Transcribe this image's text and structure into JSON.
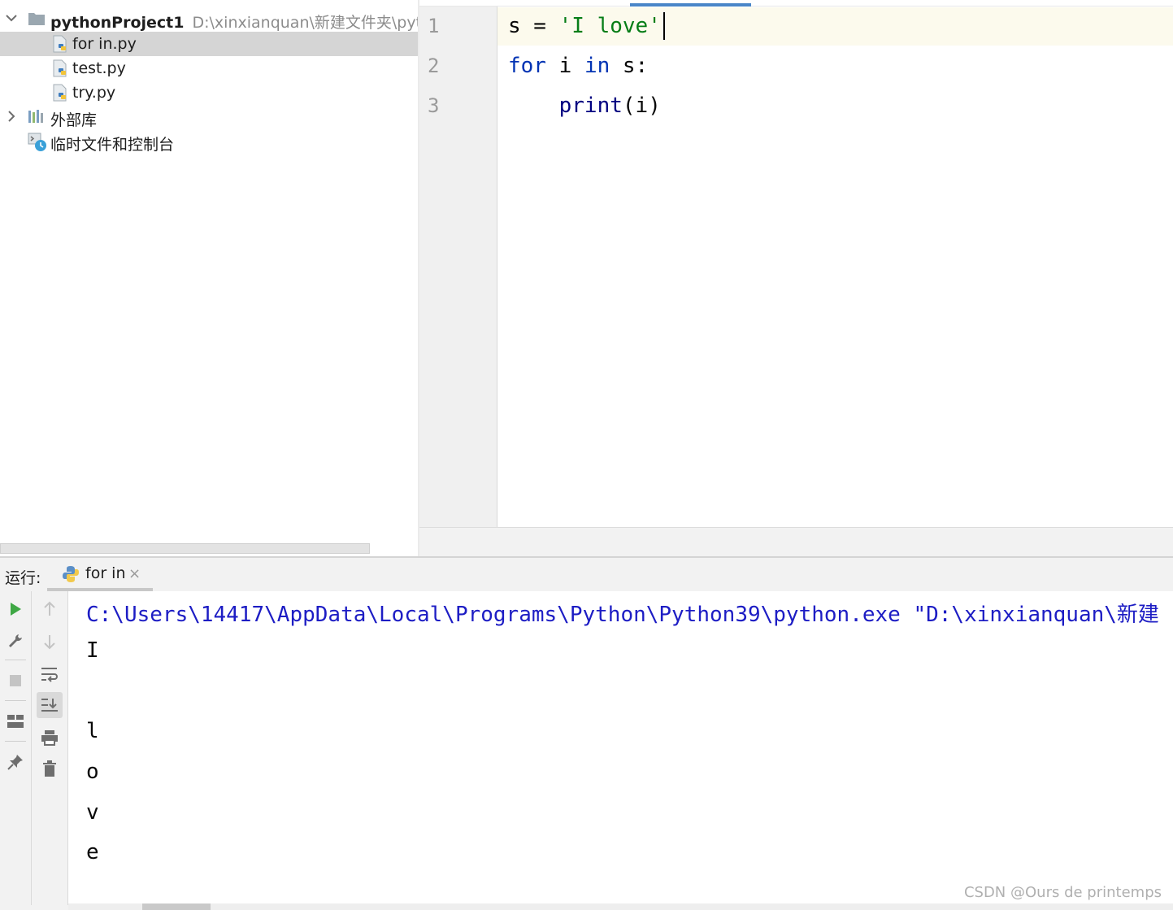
{
  "project_tree": {
    "root": {
      "name": "pythonProject1",
      "path": "D:\\xinxianquan\\新建文件夹\\pythonP"
    },
    "files": [
      {
        "name": "for in.py",
        "selected": true
      },
      {
        "name": "test.py",
        "selected": false
      },
      {
        "name": "try.py",
        "selected": false
      }
    ],
    "external_libraries": "外部库",
    "scratches": "临时文件和控制台"
  },
  "editor": {
    "line_numbers": [
      "1",
      "2",
      "3"
    ],
    "code": {
      "line1_var": "s =",
      "line1_string": "'I love'",
      "line2_kw1": "for",
      "line2_mid": " i ",
      "line2_kw2": "in",
      "line2_end": " s:",
      "line3_indent": "    ",
      "line3_fn": "print",
      "line3_args": "(i)"
    }
  },
  "run_window": {
    "title": "运行:",
    "tab_label": "for in",
    "tab_close": "×",
    "console_lines": [
      "C:\\Users\\14417\\AppData\\Local\\Programs\\Python\\Python39\\python.exe \"D:\\xinxianquan\\新建",
      "I",
      "",
      "l",
      "o",
      "v",
      "e"
    ]
  },
  "watermark": "CSDN @Ours de printemps",
  "colors": {
    "keyword": "#0033b3",
    "string": "#067d17",
    "builtin": "#000080",
    "console_command": "#1d1dc4",
    "run_green": "#3fa845",
    "selection": "#d5d5d5"
  },
  "icons": {
    "expand_root": "chevron-down-icon",
    "expand_libraries": "chevron-right-icon",
    "folder": "folder-icon",
    "python_file": "python-file-icon",
    "libraries": "library-icon",
    "scratches": "scratch-console-icon",
    "run": "run-icon",
    "wrench": "wrench-icon",
    "stop": "stop-icon",
    "layout": "layout-icon",
    "pin": "pin-icon",
    "up": "arrow-up-icon",
    "down": "arrow-down-icon",
    "soft_wrap": "soft-wrap-icon",
    "scroll_end": "scroll-to-end-icon",
    "print": "print-icon",
    "trash": "trash-icon"
  }
}
